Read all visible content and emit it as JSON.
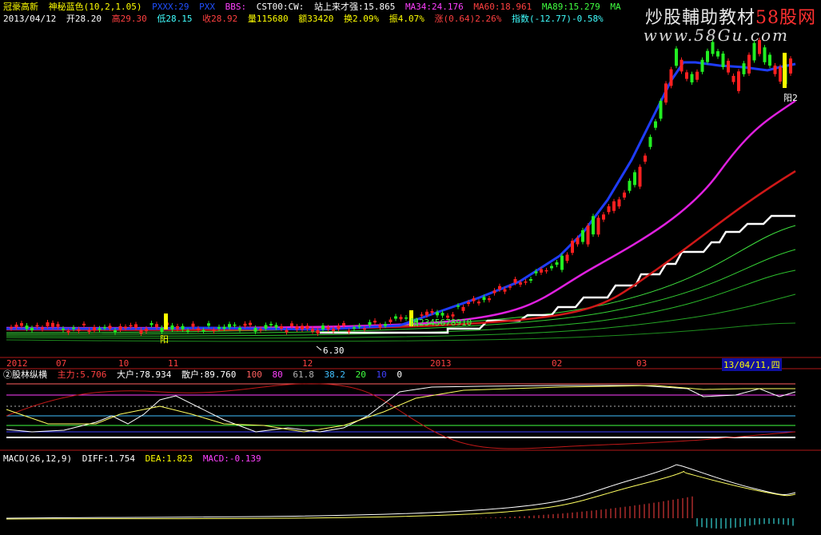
{
  "header": {
    "stock_name": "冠豪高新",
    "indicator": "神秘蓝色(10,2,1.05)",
    "ind_a": "PXXX:29",
    "ind_b": "PXX",
    "bbs_label": "BBS:",
    "cst_label": "CST00:CW:",
    "station": "站上来才强:15.865",
    "ma34": "MA34:24.176",
    "ma60": "MA60:18.961",
    "ma89": "MA89:15.279",
    "ma_more": "MA",
    "date": "2013/04/12",
    "open": "开28.20",
    "high": "高29.30",
    "low": "低28.15",
    "close": "收28.92",
    "volume": "量115680",
    "amount": "额33420",
    "turnover": "换2.09%",
    "amplitude": "振4.07%",
    "change": "涨(0.64)2.26%",
    "index": "指数(-12.77)-0.58%"
  },
  "watermark": {
    "text_a": "炒股輔助教材",
    "text_b": "58股网",
    "url": "www.58Gu.com"
  },
  "price_annotations": {
    "low_mark": "6.30",
    "yang_a": "阳",
    "yang_b": "阳2345678910",
    "yang_c": "阳2"
  },
  "time_axis": {
    "labels": [
      "2012",
      "07",
      "10",
      "11",
      "12",
      "2013",
      "02",
      "03"
    ],
    "cursor_date": "13/04/11,四"
  },
  "ind2": {
    "title": "②股林纵横",
    "main": "主力:5.706",
    "big": "大户:78.934",
    "retail": "散户:89.760",
    "l100": "100",
    "l80": "80",
    "l61": "61.8",
    "l38": "38.2",
    "l20": "20",
    "l10": "10",
    "l0": "0"
  },
  "macd": {
    "title": "MACD(26,12,9)",
    "diff": "DIFF:1.754",
    "dea": "DEA:1.823",
    "macd": "MACD:-0.139"
  },
  "colors": {
    "up": "#ff2020",
    "down": "#22ee22",
    "blue_ma": "#1e3cff",
    "magenta_ma": "#e020e0",
    "red_ma": "#d01818",
    "white_step": "#ffffff",
    "yellow": "#ffff00"
  }
}
